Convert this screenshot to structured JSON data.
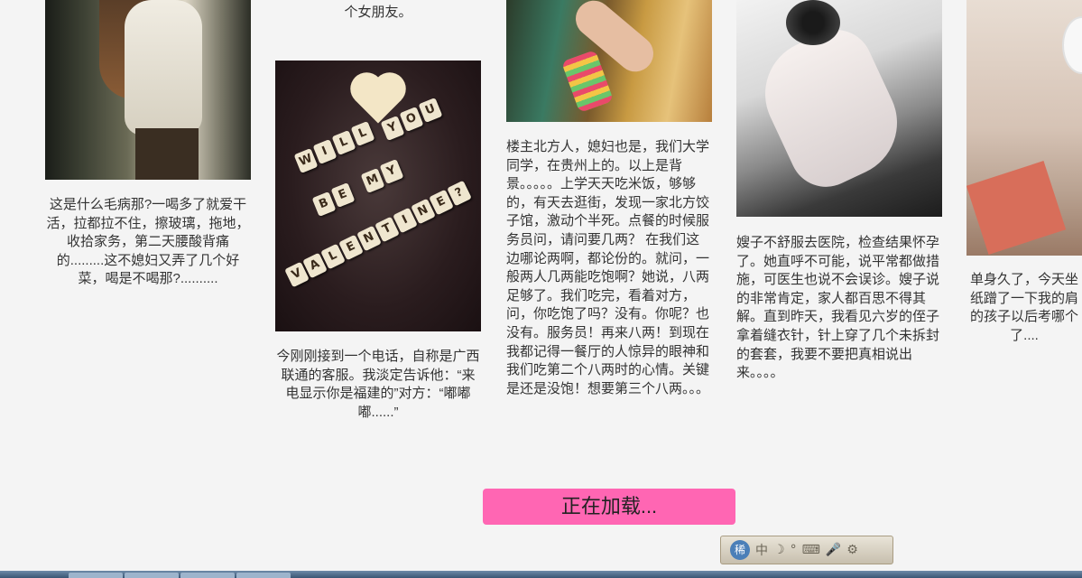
{
  "cards": [
    {
      "caption": "个女朋友。"
    },
    {
      "caption": "这是什么毛病那?一喝多了就爱干活，拉都拉不住，擦玻璃，拖地，收拾家务，第二天腰酸背痛的.........这不媳妇又弄了几个好菜，喝是不喝那?.........."
    },
    {
      "caption": "今刚刚接到一个电话，自称是广西联通的客服。我淡定告诉他：“来电显示你是福建的”对方：“嘟嘟嘟......”"
    },
    {
      "caption": "楼主北方人，媳妇也是，我们大学同学，在贵州上的。以上是背景。。。。。上学天天吃米饭，够够的，有天去逛街，发现一家北方饺子馆，激动个半死。点餐的时候服务员问，请问要几两？ 在我们这边哪论两啊，都论份的。就问，一般两人几两能吃饱啊？她说，八两足够了。我们吃完，看着对方，问，你吃饱了吗？没有。你呢？也没有。服务员！再来八两！到现在我都记得一餐厅的人惊异的眼神和我们吃第二个八两时的心情。关键是还是没饱！想要第三个八两。。。"
    },
    {
      "caption": "嫂子不舒服去医院，检查结果怀孕了。她直呼不可能，说平常都做措施，可医生也说不会误诊。嫂子说的非常肯定，家人都百思不得其解。直到昨天，我看见六岁的侄子拿着缝衣针，针上穿了几个未拆封的套套，我要不要把真相说出来。。。。"
    },
    {
      "caption": "单身久了，今天坐纸蹭了一下我的肩的孩子以后考哪个了...."
    }
  ],
  "valentine_tiles": [
    "W",
    "I",
    "L",
    "L",
    "Y",
    "O",
    "U",
    "B",
    "E",
    "M",
    "Y",
    "V",
    "A",
    "L",
    "E",
    "N",
    "T",
    "I",
    "N",
    "E",
    "?"
  ],
  "load_button": {
    "label": "正在加载..."
  },
  "ime": {
    "logo": "稀",
    "mode": "中",
    "moon": "☽",
    "dot": "°",
    "keyboard": "⌨",
    "mic": "🎤",
    "gear": "⚙"
  },
  "colors": {
    "load_button_bg": "#ff66b3",
    "page_bg": "#f4f4f4"
  }
}
